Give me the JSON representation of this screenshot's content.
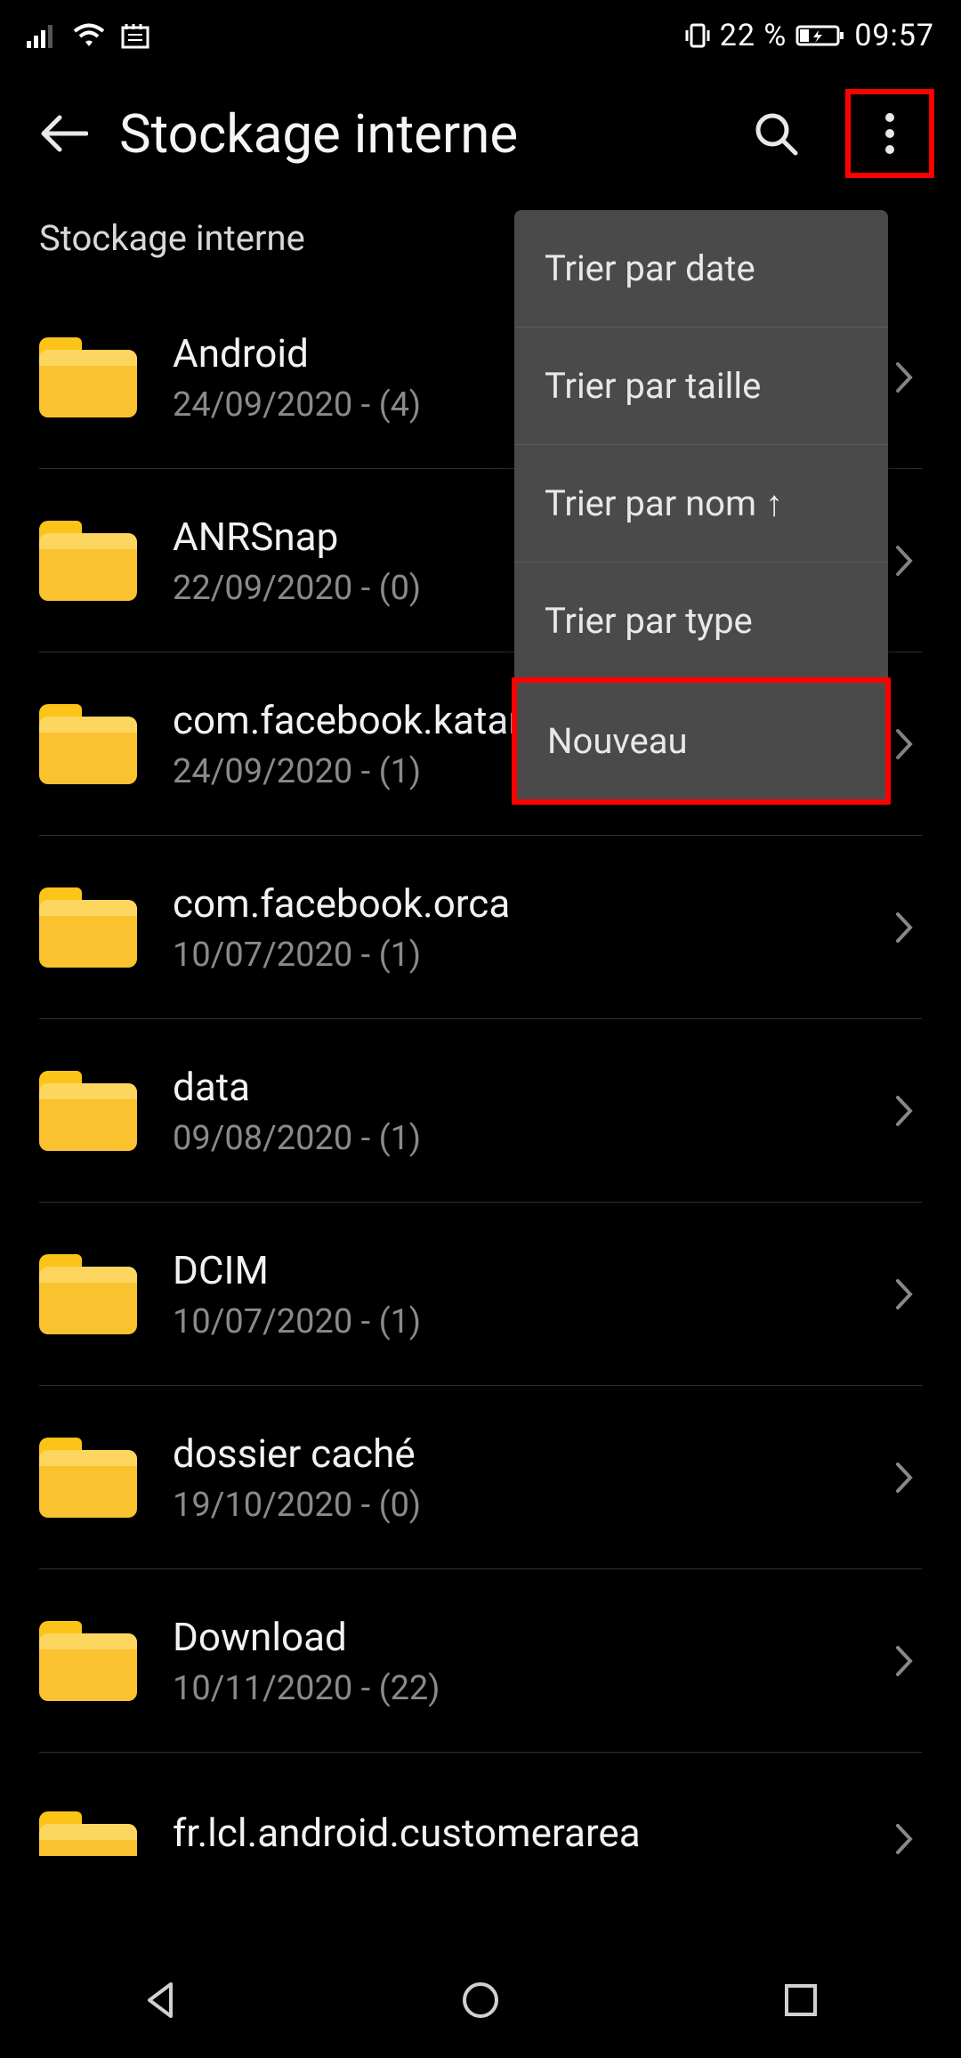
{
  "status": {
    "battery_pct": "22 %",
    "time": "09:57"
  },
  "header": {
    "title": "Stockage interne"
  },
  "breadcrumb": "Stockage interne",
  "folders": [
    {
      "name": "Android",
      "meta": "24/09/2020 - (4)"
    },
    {
      "name": "ANRSnap",
      "meta": "22/09/2020 - (0)"
    },
    {
      "name": "com.facebook.katana",
      "meta": "24/09/2020 - (1)"
    },
    {
      "name": "com.facebook.orca",
      "meta": "10/07/2020 - (1)"
    },
    {
      "name": "data",
      "meta": "09/08/2020 - (1)"
    },
    {
      "name": "DCIM",
      "meta": "10/07/2020 - (1)"
    },
    {
      "name": "dossier caché",
      "meta": "19/10/2020 - (0)"
    },
    {
      "name": "Download",
      "meta": "10/11/2020 - (22)"
    },
    {
      "name": "fr.lcl.android.customerarea",
      "meta": ""
    }
  ],
  "dropdown": {
    "items": [
      {
        "label": "Trier par date"
      },
      {
        "label": "Trier par taille"
      },
      {
        "label": "Trier par nom ↑"
      },
      {
        "label": "Trier par type"
      },
      {
        "label": "Nouveau"
      }
    ]
  }
}
